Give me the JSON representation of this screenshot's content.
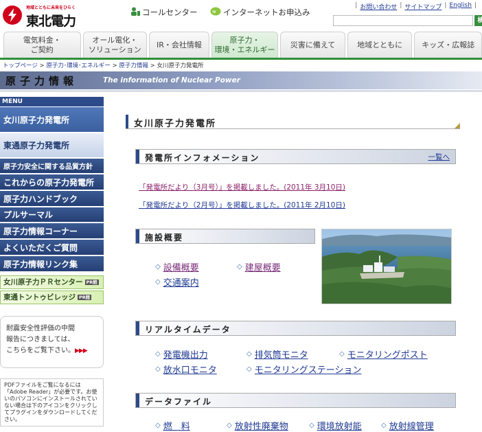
{
  "header": {
    "logo_tagline": "地域とともに未来をひらく",
    "logo_name": "東北電力",
    "call_center": "コールセンター",
    "internet_apply": "インターネットお申込み",
    "top_links": [
      "お問い合わせ",
      "サイトマップ",
      "English"
    ],
    "search_button": "検索"
  },
  "nav": {
    "tabs": [
      {
        "label_1": "電気料金・",
        "label_2": "ご契約"
      },
      {
        "label_1": "オール電化・",
        "label_2": "ソリューション"
      },
      {
        "label_1": "IR・会社情報",
        "label_2": ""
      },
      {
        "label_1": "原子力・",
        "label_2": "環境・エネルギー"
      },
      {
        "label_1": "災害に備えて",
        "label_2": ""
      },
      {
        "label_1": "地域とともに",
        "label_2": ""
      },
      {
        "label_1": "キッズ・広報誌",
        "label_2": ""
      }
    ]
  },
  "breadcrumb": [
    "トップページ",
    "原子力･環境･エネルギー",
    "原子力情報",
    "女川原子力発電所"
  ],
  "banner": {
    "jp": "原子力情報",
    "en": "The information of Nuclear Power"
  },
  "sidebar": {
    "menu_label": "MENU",
    "items": [
      "女川原子力発電所",
      "東通原子力発電所",
      "原子力安全に関する品質方針",
      "これからの原子力発電所",
      "原子力ハンドブック",
      "プルサーマル",
      "原子力情報コーナー",
      "よくいただくご質問",
      "原子力情報リンク集"
    ],
    "pr_centers": [
      "女川原子力ＰＲセンター",
      "東通トントゥビレッジ"
    ],
    "pr_badge": "PR館",
    "notice_1": "耐震安全性評価の中間",
    "notice_2": "報告につきましては、",
    "notice_3": "こちらをご覧下さい。",
    "notice_arrows": "▶▶▶",
    "pdf_text": "PDFファイルをご覧になるには「Adobe Reader」が必要です。お使いのパソコンにインストールされていない場合は下のアイコンをクリックしてプラグインをダウンロードしてください。"
  },
  "main": {
    "title": "女川原子力発電所",
    "info_section": "発電所インフォメーション",
    "info_more": "一覧へ",
    "news": [
      "「発電所だより（3月号）」を掲載しました。(2011年 3月10日)",
      "「発電所だより（2月号）」を掲載しました。(2011年 2月10日)"
    ],
    "facility_section": "施設概要",
    "facility_links": [
      "設備概要",
      "建屋概要",
      "交通案内"
    ],
    "realtime_section": "リアルタイムデータ",
    "realtime_links": [
      "発電機出力",
      "排気筒モニタ",
      "モニタリングポスト",
      "放水口モニタ",
      "モニタリングステーション"
    ],
    "datafile_section": "データファイル",
    "datafile_links": [
      "燃　料",
      "放射性廃棄物",
      "環境放射能",
      "放射線管理"
    ]
  }
}
